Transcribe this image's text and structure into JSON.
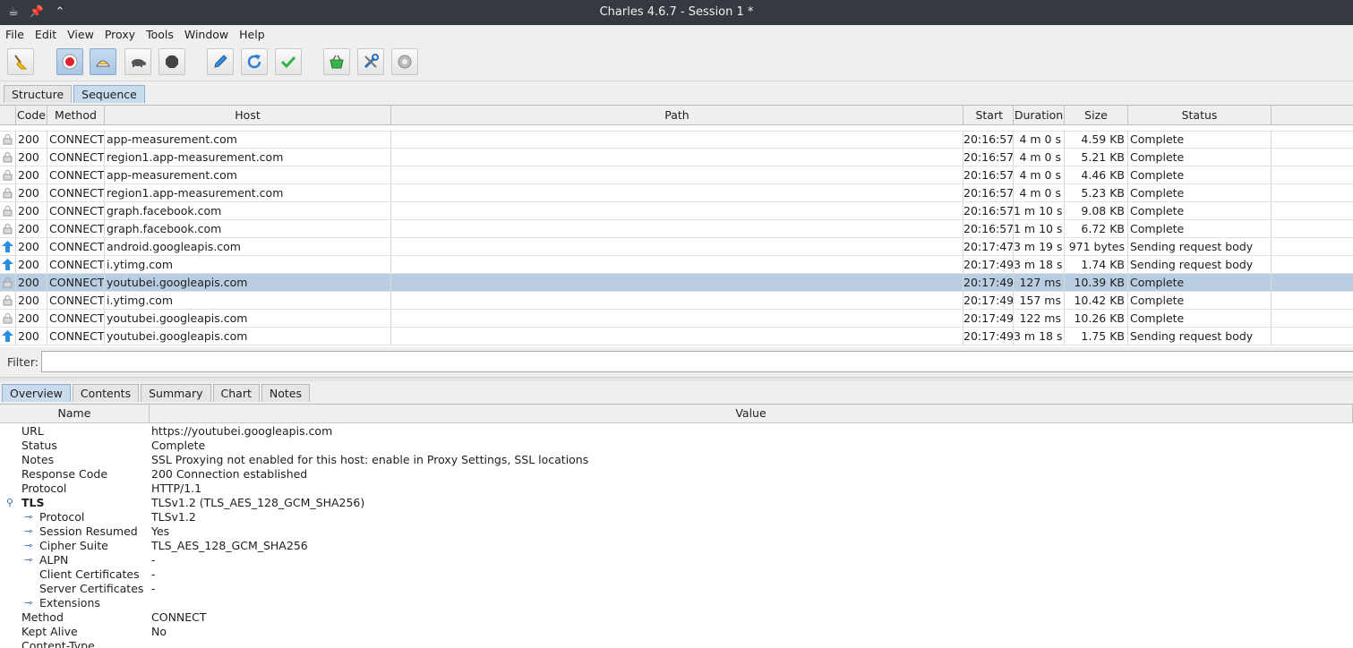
{
  "window": {
    "title": "Charles 4.6.7 - Session 1 *",
    "title_icons": [
      "charles-jug-icon",
      "pin-icon",
      "double-chevron-up-icon"
    ]
  },
  "menu": [
    "File",
    "Edit",
    "View",
    "Proxy",
    "Tools",
    "Window",
    "Help"
  ],
  "toolbar": [
    {
      "name": "clear-session-broom-icon",
      "active": false
    },
    {
      "name": "record-icon",
      "active": true
    },
    {
      "name": "throttle-icon",
      "active": true
    },
    {
      "name": "turtle-icon",
      "active": false
    },
    {
      "name": "stop-breakpoints-icon",
      "active": false
    },
    {
      "name": "compose-pen-icon",
      "active": false
    },
    {
      "name": "repeat-refresh-icon",
      "active": false
    },
    {
      "name": "validate-check-icon",
      "active": false
    },
    {
      "name": "shopping-basket-icon",
      "active": false
    },
    {
      "name": "tools-wrench-icon",
      "active": false
    },
    {
      "name": "settings-gear-icon",
      "active": false
    }
  ],
  "view_tabs": [
    {
      "label": "Structure",
      "active": false
    },
    {
      "label": "Sequence",
      "active": true
    }
  ],
  "table": {
    "columns": [
      "Code",
      "Method",
      "Host",
      "Path",
      "Start",
      "Duration",
      "Size",
      "Status"
    ],
    "rows": [
      {
        "icon": "lock",
        "code": "200",
        "method": "CONNECT",
        "host": "app-measurement.com",
        "path": "",
        "start": "20:16:57",
        "duration": "4 m 0 s",
        "size": "4.59 KB",
        "status": "Complete",
        "selected": false
      },
      {
        "icon": "lock",
        "code": "200",
        "method": "CONNECT",
        "host": "region1.app-measurement.com",
        "path": "",
        "start": "20:16:57",
        "duration": "4 m 0 s",
        "size": "5.21 KB",
        "status": "Complete",
        "selected": false
      },
      {
        "icon": "lock",
        "code": "200",
        "method": "CONNECT",
        "host": "app-measurement.com",
        "path": "",
        "start": "20:16:57",
        "duration": "4 m 0 s",
        "size": "4.46 KB",
        "status": "Complete",
        "selected": false
      },
      {
        "icon": "lock",
        "code": "200",
        "method": "CONNECT",
        "host": "region1.app-measurement.com",
        "path": "",
        "start": "20:16:57",
        "duration": "4 m 0 s",
        "size": "5.23 KB",
        "status": "Complete",
        "selected": false
      },
      {
        "icon": "lock",
        "code": "200",
        "method": "CONNECT",
        "host": "graph.facebook.com",
        "path": "",
        "start": "20:16:57",
        "duration": "1 m 10 s",
        "size": "9.08 KB",
        "status": "Complete",
        "selected": false
      },
      {
        "icon": "lock",
        "code": "200",
        "method": "CONNECT",
        "host": "graph.facebook.com",
        "path": "",
        "start": "20:16:57",
        "duration": "1 m 10 s",
        "size": "6.72 KB",
        "status": "Complete",
        "selected": false
      },
      {
        "icon": "upload-arrow",
        "code": "200",
        "method": "CONNECT",
        "host": "android.googleapis.com",
        "path": "",
        "start": "20:17:47",
        "duration": "3 m 19 s",
        "size": "971 bytes",
        "status": "Sending request body",
        "selected": false
      },
      {
        "icon": "upload-arrow",
        "code": "200",
        "method": "CONNECT",
        "host": "i.ytimg.com",
        "path": "",
        "start": "20:17:49",
        "duration": "3 m 18 s",
        "size": "1.74 KB",
        "status": "Sending request body",
        "selected": false
      },
      {
        "icon": "lock",
        "code": "200",
        "method": "CONNECT",
        "host": "youtubei.googleapis.com",
        "path": "",
        "start": "20:17:49",
        "duration": "127 ms",
        "size": "10.39 KB",
        "status": "Complete",
        "selected": true
      },
      {
        "icon": "lock",
        "code": "200",
        "method": "CONNECT",
        "host": "i.ytimg.com",
        "path": "",
        "start": "20:17:49",
        "duration": "157 ms",
        "size": "10.42 KB",
        "status": "Complete",
        "selected": false
      },
      {
        "icon": "lock",
        "code": "200",
        "method": "CONNECT",
        "host": "youtubei.googleapis.com",
        "path": "",
        "start": "20:17:49",
        "duration": "122 ms",
        "size": "10.26 KB",
        "status": "Complete",
        "selected": false
      },
      {
        "icon": "upload-arrow",
        "code": "200",
        "method": "CONNECT",
        "host": "youtubei.googleapis.com",
        "path": "",
        "start": "20:17:49",
        "duration": "3 m 18 s",
        "size": "1.75 KB",
        "status": "Sending request body",
        "selected": false
      }
    ]
  },
  "filter": {
    "label": "Filter:",
    "value": ""
  },
  "detail_tabs": [
    {
      "label": "Overview",
      "active": true
    },
    {
      "label": "Contents",
      "active": false
    },
    {
      "label": "Summary",
      "active": false
    },
    {
      "label": "Chart",
      "active": false
    },
    {
      "label": "Notes",
      "active": false
    }
  ],
  "overview": {
    "columns": [
      "Name",
      "Value"
    ],
    "rows": [
      {
        "name": "URL",
        "value": "https://youtubei.googleapis.com",
        "level": 0,
        "expander": "none",
        "bold": false
      },
      {
        "name": "Status",
        "value": "Complete",
        "level": 0,
        "expander": "none",
        "bold": false
      },
      {
        "name": "Notes",
        "value": "SSL Proxying not enabled for this host: enable in Proxy Settings, SSL locations",
        "level": 0,
        "expander": "none",
        "bold": false
      },
      {
        "name": "Response Code",
        "value": "200 Connection established",
        "level": 0,
        "expander": "none",
        "bold": false
      },
      {
        "name": "Protocol",
        "value": "HTTP/1.1",
        "level": 0,
        "expander": "none",
        "bold": false
      },
      {
        "name": "TLS",
        "value": "TLSv1.2 (TLS_AES_128_GCM_SHA256)",
        "level": 0,
        "expander": "expanded",
        "bold": true
      },
      {
        "name": "Protocol",
        "value": "TLSv1.2",
        "level": 1,
        "expander": "collapsed",
        "bold": false
      },
      {
        "name": "Session Resumed",
        "value": "Yes",
        "level": 1,
        "expander": "collapsed",
        "bold": false
      },
      {
        "name": "Cipher Suite",
        "value": "TLS_AES_128_GCM_SHA256",
        "level": 1,
        "expander": "collapsed",
        "bold": false
      },
      {
        "name": "ALPN",
        "value": "-",
        "level": 1,
        "expander": "collapsed",
        "bold": false
      },
      {
        "name": "Client Certificates",
        "value": "-",
        "level": 1,
        "expander": "none",
        "bold": false
      },
      {
        "name": "Server Certificates",
        "value": "-",
        "level": 1,
        "expander": "none",
        "bold": false
      },
      {
        "name": "Extensions",
        "value": "",
        "level": 1,
        "expander": "collapsed",
        "bold": false
      },
      {
        "name": "Method",
        "value": "CONNECT",
        "level": 0,
        "expander": "none",
        "bold": false
      },
      {
        "name": "Kept Alive",
        "value": "No",
        "level": 0,
        "expander": "none",
        "bold": false
      },
      {
        "name": "Content-Type",
        "value": "",
        "level": 0,
        "expander": "none",
        "bold": false
      }
    ]
  },
  "colors": {
    "titlebar": "#353a40",
    "selection": "#b9cde3",
    "active_tab": "#c9dcee",
    "upload_arrow": "#2a8ee0",
    "record_red": "#e0202a",
    "check_green": "#2fb24a",
    "refresh_blue": "#2a7fd4"
  }
}
